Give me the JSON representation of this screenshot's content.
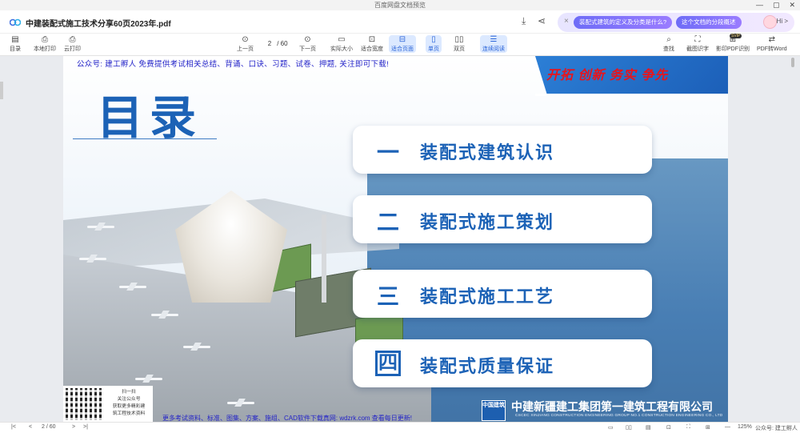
{
  "window": {
    "title": "百度网盘文档预览",
    "controls": [
      "—",
      "▢",
      "✕"
    ]
  },
  "tab": {
    "doc_title": "中建装配式施工技术分享60页2023年.pdf",
    "icons": [
      "download-icon",
      "share-icon"
    ]
  },
  "ai": {
    "close": "×",
    "pill_1": "装配式建筑的定义及分类是什么?",
    "pill_2": "这个文档的分段概述",
    "hi": "Hi >"
  },
  "toolbar": {
    "outline": "目录",
    "local_print": "本地打印",
    "cloud_print": "云打印",
    "prev": "上一页",
    "page_current": "2",
    "page_total": "/ 60",
    "next": "下一页",
    "actual_size": "实际大小",
    "fit_width": "适合宽度",
    "fit_page": "适合页面",
    "single": "单页",
    "double": "双页",
    "continuous": "连续阅读",
    "find": "查找",
    "screenshot": "截图识字",
    "print_pdf": "影印PDF识别",
    "svip": "SVIP",
    "pdf_word": "PDF转Word"
  },
  "chart_data": {
    "type": "table",
    "title": "目录",
    "items": [
      {
        "index": "一",
        "label": "装配式建筑认识"
      },
      {
        "index": "二",
        "label": "装配式施工策划"
      },
      {
        "index": "三",
        "label": "装配式施工工艺"
      },
      {
        "index": "四",
        "label": "装配式质量保证"
      }
    ]
  },
  "page": {
    "notice_top": "公众号: 建工孵人 免费提供考试相关总结、背诵、口诀、习题、试卷、押题, 关注即可下载!",
    "slogan": "开拓  创新  务实  争先",
    "company": "中建新疆建工集团第一建筑工程有限公司",
    "company_en": "CSCEC XINJIANG CONSTRUCTION ENGINEERING GROUP NO.1 CONSTRUCTION ENGINEERING CO., LTD",
    "company_logo": "中国建筑",
    "qr_text": [
      "扫一扫",
      "关注公众号",
      "获取更多精彩建",
      "筑工程技术资料"
    ],
    "notice_bottom": "更多考试资料、标准、图集、方案、施组、CAD软件下载真网: wdzrk.com 查看每日更新!"
  },
  "status": {
    "first": "|<",
    "prev": "<",
    "page": "2 / 60",
    "next": ">",
    "last": ">|",
    "zoom_minus": "—",
    "zoom": "125%",
    "watermark": "公众号: 建工孵人"
  },
  "colors": {
    "brand_blue": "#1c62b6",
    "slogan_red": "#e8141b",
    "ai_pill": "#7a72f8"
  }
}
